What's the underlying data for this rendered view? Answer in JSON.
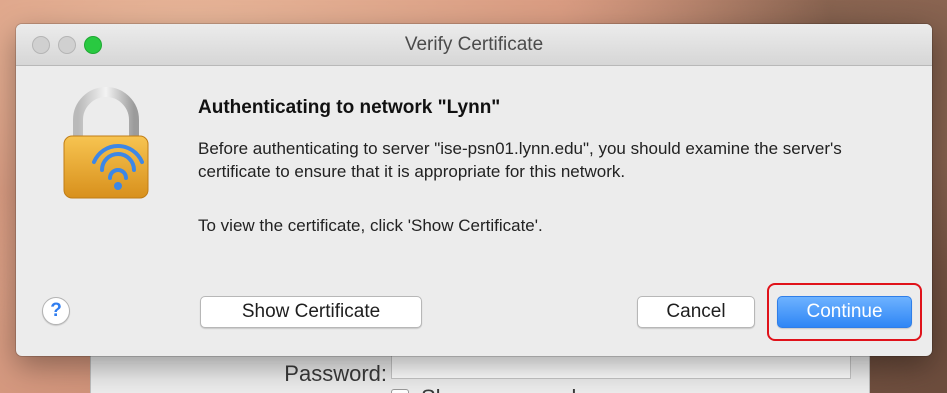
{
  "window": {
    "title": "Verify Certificate"
  },
  "dialog": {
    "heading": "Authenticating to network \"Lynn\"",
    "message": "Before authenticating to server \"ise-psn01.lynn.edu\", you should examine the server's certificate to ensure that it is appropriate for this network.",
    "instruction": "To view the certificate, click 'Show Certificate'."
  },
  "buttons": {
    "help_label": "?",
    "show_certificate": "Show Certificate",
    "cancel": "Cancel",
    "continue": "Continue"
  },
  "background_sheet": {
    "password_label": "Password:",
    "show_password_label": "Show password"
  },
  "colors": {
    "accent": "#2f86f5",
    "highlight": "#e0121a",
    "zoom_button": "#29c941"
  }
}
